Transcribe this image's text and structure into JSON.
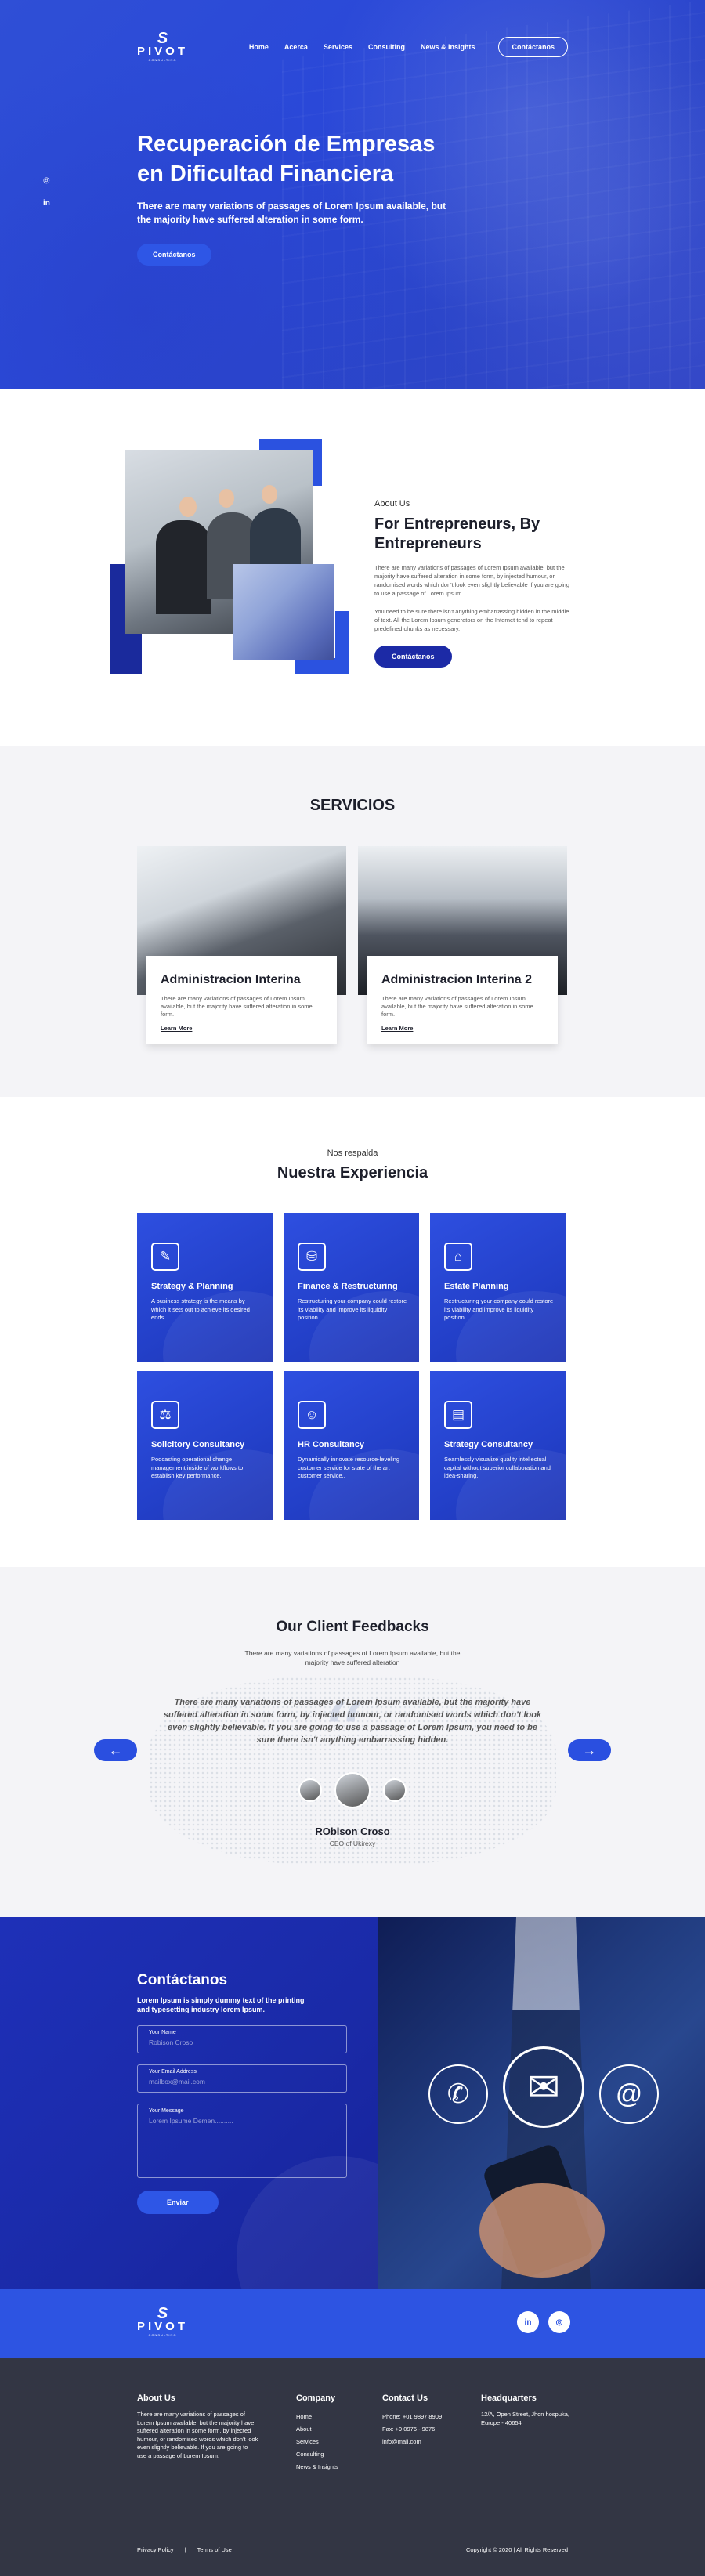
{
  "brand": {
    "mark": "S",
    "name": "PIVOT",
    "sub": "CONSULTING"
  },
  "nav": {
    "items": [
      "Home",
      "Acerca",
      "Services",
      "Consulting",
      "News & Insights"
    ],
    "cta": "Contáctanos"
  },
  "hero": {
    "title": "Recuperación de Empresas en Dificultad Financiera",
    "subtitle": "There are many variations of passages of Lorem Ipsum available, but the majority have suffered alteration in some form.",
    "cta": "Contáctanos",
    "social": [
      "instagram-icon",
      "linkedin-icon"
    ]
  },
  "about": {
    "kicker": "About Us",
    "title": "For Entrepreneurs, By Entrepreneurs",
    "p1": "There are many variations of passages of Lorem Ipsum available, but the majority have suffered alteration in some form, by injected humour, or randomised words which don't look even slightly believable if you are going to use a passage of Lorem Ipsum.",
    "p2": "You need to be sure there isn't anything embarrassing hidden in the middle of text. All the Lorem Ipsum generators on the Internet tend to repeat predefined chunks as necessary.",
    "cta": "Contáctanos"
  },
  "services": {
    "title": "SERVICIOS",
    "cards": [
      {
        "title": "Administracion Interina",
        "text": "There are many variations of passages of Lorem Ipsum available, but the majority have suffered alteration in some form.",
        "link": "Learn More"
      },
      {
        "title": "Administracion Interina 2",
        "text": "There are many variations of passages of Lorem Ipsum available, but the majority have suffered alteration in some form.",
        "link": "Learn More"
      }
    ]
  },
  "experience": {
    "kicker": "Nos respalda",
    "title": "Nuestra Experiencia",
    "cards": [
      {
        "icon": "strategy-icon",
        "title": "Strategy & Planning",
        "text": "A business strategy is the means by which it sets out to achieve its desired ends."
      },
      {
        "icon": "finance-icon",
        "title": "Finance & Restructuring",
        "text": "Restructuring your company could restore its viability and improve its liquidity position."
      },
      {
        "icon": "estate-icon",
        "title": "Estate Planning",
        "text": "Restructuring your company could restore its viability and improve its liquidity position."
      },
      {
        "icon": "solicitory-icon",
        "title": "Solicitory Consultancy",
        "text": "Podcasting operational change management inside of workflows to establish key performance.."
      },
      {
        "icon": "hr-icon",
        "title": "HR Consultancy",
        "text": "Dynamically innovate resource-leveling customer service for state of the art customer service.."
      },
      {
        "icon": "presentation-icon",
        "title": "Strategy Consultancy",
        "text": "Seamlessly visualize quality intellectual capital without superior collaboration and idea-sharing.."
      }
    ]
  },
  "testimonials": {
    "title": "Our Client Feedbacks",
    "subtitle": "There are many variations of passages of Lorem Ipsum available, but the majority have suffered alteration",
    "quote": "There are many variations of passages of Lorem Ipsum available, but the majority have suffered alteration in some form, by injected humour, or randomised words which don't look even slightly believable. If you are going to use a passage of Lorem Ipsum, you need to be sure there isn't anything embarrassing hidden.",
    "name": "ROblson Croso",
    "role": "CEO of Ukirexy",
    "prev": "←",
    "next": "→"
  },
  "contact": {
    "title": "Contáctanos",
    "lead": "Lorem Ipsum is simply dummy text of the printing and typesetting industry lorem Ipsum.",
    "name_label": "Your Name",
    "name_placeholder": "Robison Croso",
    "email_label": "Your Email Address",
    "email_placeholder": "mailbox@mail.com",
    "msg_label": "Your Message",
    "msg_placeholder": "Lorem Ipsume Demen..........",
    "submit": "Enviar"
  },
  "footer": {
    "about_title": "About Us",
    "about_text": "There are many variations of passages of Lorem Ipsum available, but the majority have suffered alteration in some form, by injected humour, or randomised words which don't look even slightly believable. If you are going to use a passage of Lorem Ipsum.",
    "company_title": "Company",
    "company_items": [
      "Home",
      "About",
      "Services",
      "Consulting",
      "News & Insights"
    ],
    "contact_title": "Contact Us",
    "phone": "Phone: +01 9897 8909",
    "fax": "Fax: +9 0976 - 9876",
    "email": "info@mail.com",
    "hq_title": "Headquarters",
    "hq_text": "12/A, Open Street, Jhon hospuka, Europe - 40654",
    "privacy": "Privacy Policy",
    "sep": "|",
    "terms": "Terms of Use",
    "copyright": "Copyright © 2020 | All Rights Reserved",
    "social": [
      "in",
      "◎"
    ]
  }
}
